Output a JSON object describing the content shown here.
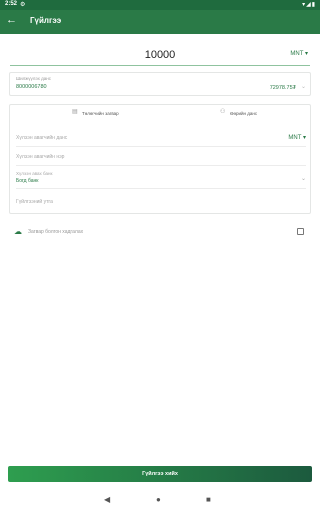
{
  "status_bar": {
    "time": "2:52",
    "settings_glyph": "⚙",
    "sys_glyphs": "▾◢▮"
  },
  "app_bar": {
    "back_glyph": "←",
    "title": "Гүйлгээ"
  },
  "amount": {
    "value": "10000",
    "currency": "MNT ▾"
  },
  "from_account": {
    "label": "Шилжүүлэх данс",
    "number": "8000006780",
    "balance": "72978.75₮",
    "chevron": "⌄"
  },
  "tabs": [
    {
      "label": "Төлөгчийн загвар",
      "icon": "document-icon"
    },
    {
      "label": "Өөрийн данс",
      "icon": "person-icon"
    }
  ],
  "to_fields": {
    "account_placeholder": "Хүлээн авагчийн данс",
    "account_currency": "MNT ▾",
    "name_placeholder": "Хүлээн авагчийн нэр",
    "bank_label": "Хүлээн авах банк",
    "bank_value": "Богд банк",
    "bank_chevron": "⌄",
    "description_placeholder": "Гүйлгээний утга"
  },
  "save_template": {
    "label": "Загвар болгон хадгалах",
    "checked": false
  },
  "submit_label": "Гүйлгээ хийх",
  "nav": {
    "back": "◀",
    "home": "●",
    "recent": "■"
  }
}
